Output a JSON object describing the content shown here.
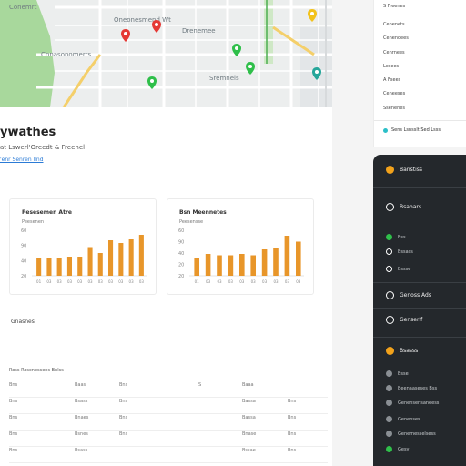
{
  "map": {
    "labels": [
      "Cnnasonomerrs",
      "Oneonesmend Wt",
      "Drenemee",
      "Sremnels",
      "Conemrt"
    ]
  },
  "page": {
    "title": "ywathes",
    "subtitle": "at Lswerl'Oreedt & Freenel",
    "link": "'enr Senren llnd"
  },
  "charts": {
    "left": {
      "title": "Pesesemen Atre",
      "subtitle": "Peesenen"
    },
    "right": {
      "title": "Bsn Meennetes",
      "subtitle": "Peesensse"
    }
  },
  "chart_data": [
    {
      "type": "bar",
      "title": "Pesesemen Atre",
      "ylabel": "",
      "xlabel": "",
      "yticks": [
        "60",
        "90",
        "40",
        "20"
      ],
      "ylim": [
        0,
        100
      ],
      "categories": [
        "01",
        "03",
        "03",
        "03",
        "03",
        "03",
        "03",
        "03",
        "03",
        "03",
        "03"
      ],
      "values": [
        38,
        40,
        40,
        42,
        42,
        63,
        50,
        78,
        72,
        80,
        90
      ]
    },
    {
      "type": "bar",
      "title": "Bsn Meennetes",
      "ylabel": "",
      "xlabel": "",
      "yticks": [
        "60",
        "90",
        "40",
        "20",
        "20"
      ],
      "ylim": [
        0,
        100
      ],
      "categories": [
        "01",
        "03",
        "03",
        "03",
        "03",
        "03",
        "03",
        "03",
        "03",
        "03",
        "03"
      ],
      "values": [
        38,
        48,
        45,
        45,
        48,
        45,
        58,
        60,
        88,
        75
      ]
    }
  ],
  "section": {
    "heading": "Gnasnes"
  },
  "table": {
    "header": "Ross Roscnessens Bnlss",
    "columns": [
      "",
      "",
      "",
      "",
      "",
      ""
    ],
    "rows": [
      [
        "Bns",
        "Baas",
        "Bns",
        "S",
        "Baaa",
        ""
      ],
      [
        "Bns",
        "Bsass",
        "Bns",
        "",
        "Bassa",
        "Bns"
      ],
      [
        "Bns",
        "Bnaes",
        "Bns",
        "",
        "Bassa",
        "Bns"
      ],
      [
        "Bns",
        "Bsnes",
        "Bns",
        "",
        "Bnase",
        "Bns"
      ],
      [
        "Bns",
        "Bsass",
        "",
        "",
        "Bssae",
        "Bns"
      ]
    ]
  },
  "right_panel": {
    "items": [
      "S Freenes",
      "Cenenets",
      "Cenenoees",
      "Cenrnees",
      "Lesees",
      "A Fsees",
      "Ceneeses",
      "Ssenenes"
    ],
    "footer": "Sens Lsnsslt Sed Lsss"
  },
  "dark_nav": {
    "sections": [
      {
        "label": "Banstiss",
        "icon": "orange-circle-icon",
        "color": "#f2a21b"
      },
      {
        "label": "Bsabars",
        "icon": "outline-circle-icon",
        "color": "#ffffff"
      },
      {
        "label": "Genoss Ads",
        "icon": "outline-circle-icon",
        "color": "#ffffff"
      },
      {
        "label": "Genserif",
        "icon": "outline-circle-icon",
        "color": "#ffffff"
      },
      {
        "label": "Bsasss",
        "icon": "orange-circle-icon",
        "color": "#f2a21b"
      }
    ],
    "subitems_a": [
      {
        "label": "Bss",
        "icon": "green-circle-icon",
        "color": "#2fbf4a"
      },
      {
        "label": "Bssass",
        "icon": "outline-circle-icon",
        "color": "#ffffff"
      },
      {
        "label": "Bssse",
        "icon": "outline-circle-icon",
        "color": "#ffffff"
      }
    ],
    "subitems_b": [
      {
        "label": "Bsse",
        "icon": "grey-circle-icon",
        "color": "#8a8f94"
      },
      {
        "label": "Beenaaseses Bss",
        "icon": "grey-circle-icon",
        "color": "#8a8f94"
      },
      {
        "label": "Genensensaneess",
        "icon": "grey-circle-icon",
        "color": "#8a8f94"
      },
      {
        "label": "Genenses",
        "icon": "grey-circle-icon",
        "color": "#8a8f94"
      },
      {
        "label": "Genemesselsess",
        "icon": "grey-circle-icon",
        "color": "#8a8f94"
      },
      {
        "label": "Gesy",
        "icon": "green-circle-icon",
        "color": "#2fbf4a"
      }
    ]
  },
  "colors": {
    "bar": "#e8962a",
    "accent": "#2b7bd6",
    "nav_bg": "#24282c",
    "park": "#a8d89c"
  }
}
